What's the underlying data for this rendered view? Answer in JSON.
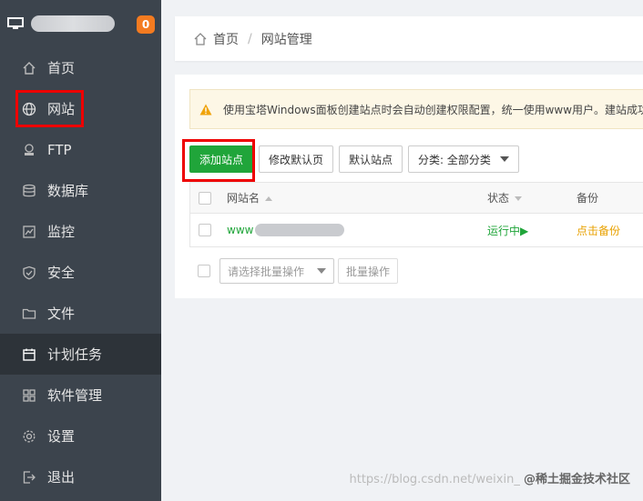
{
  "sidebar": {
    "badge": "0",
    "items": [
      {
        "label": "首页",
        "icon": "home-icon"
      },
      {
        "label": "网站",
        "icon": "globe-icon"
      },
      {
        "label": "FTP",
        "icon": "ftp-icon"
      },
      {
        "label": "数据库",
        "icon": "database-icon"
      },
      {
        "label": "监控",
        "icon": "monitor-chart-icon"
      },
      {
        "label": "安全",
        "icon": "shield-icon"
      },
      {
        "label": "文件",
        "icon": "folder-icon"
      },
      {
        "label": "计划任务",
        "icon": "calendar-icon"
      },
      {
        "label": "软件管理",
        "icon": "grid-icon"
      },
      {
        "label": "设置",
        "icon": "gear-icon"
      },
      {
        "label": "退出",
        "icon": "logout-icon"
      }
    ]
  },
  "breadcrumb": {
    "home": "首页",
    "separator": "/",
    "current": "网站管理"
  },
  "notice": {
    "text": "使用宝塔Windows面板创建站点时会自动创建权限配置，统一使用www用户。建站成功"
  },
  "toolbar": {
    "add_site": "添加站点",
    "modify_default_page": "修改默认页",
    "default_site": "默认站点",
    "category": "分类: 全部分类"
  },
  "table": {
    "headers": {
      "name": "网站名",
      "status": "状态",
      "backup": "备份"
    },
    "rows": [
      {
        "name_prefix": "www",
        "status": "运行中▶",
        "backup": "点击备份"
      }
    ]
  },
  "batch": {
    "select_placeholder": "请选择批量操作",
    "button": "批量操作"
  },
  "watermark": {
    "url": "https://blog.csdn.net/weixin_",
    "brand": "@稀土掘金技术社区"
  },
  "colors": {
    "sidebar_bg": "#3c444d",
    "accent_green": "#20a53a",
    "badge_orange": "#f47b20",
    "highlight_red": "#ee0000"
  }
}
